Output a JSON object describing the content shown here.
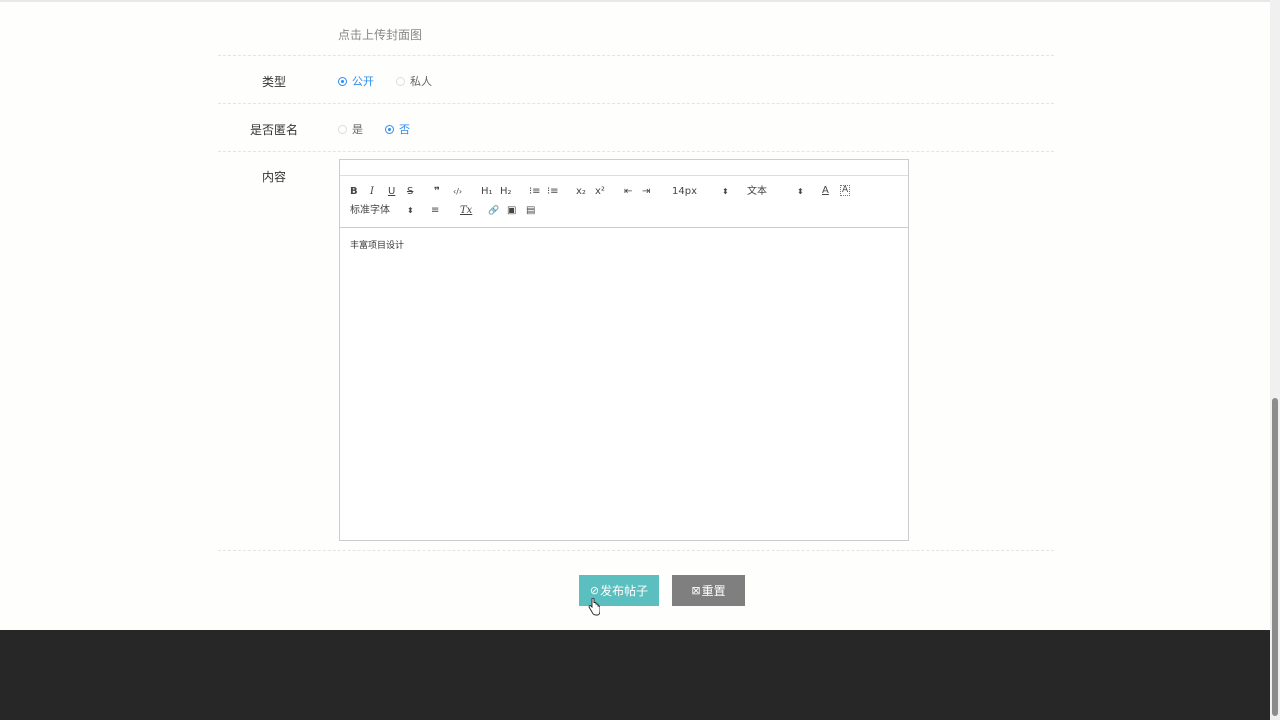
{
  "upload": {
    "text": "点击上传封面图"
  },
  "type_field": {
    "label": "类型",
    "options": [
      {
        "label": "公开",
        "checked": true
      },
      {
        "label": "私人",
        "checked": false
      }
    ]
  },
  "anonymous_field": {
    "label": "是否匿名",
    "options": [
      {
        "label": "是",
        "checked": false
      },
      {
        "label": "否",
        "checked": true
      }
    ]
  },
  "content_field": {
    "label": "内容",
    "editor": {
      "toolbar": {
        "bold": "B",
        "italic": "I",
        "underline": "U",
        "strike": "S",
        "quote": "❞",
        "code": "‹/›",
        "h1": "H₁",
        "h2": "H₂",
        "ordered_list": "⁝≡",
        "bullet_list": "⁝≡",
        "subscript": "x₂",
        "superscript": "x²",
        "outdent": "⇤",
        "indent": "⇥",
        "size": "14px",
        "header": "文本",
        "font_color": "A",
        "background": "A",
        "font_family": "标准字体",
        "align": "≡",
        "clean": "Tx",
        "link": "🔗",
        "image": "▣",
        "video": "▤"
      },
      "content_text": "丰富项目设计"
    }
  },
  "buttons": {
    "publish": "发布帖子",
    "reset": "重置"
  },
  "colors": {
    "accent": "#2d8cf0",
    "publish_bg": "#5bbfbf",
    "reset_bg": "#7f7f7f",
    "footer_bg": "#272727"
  }
}
